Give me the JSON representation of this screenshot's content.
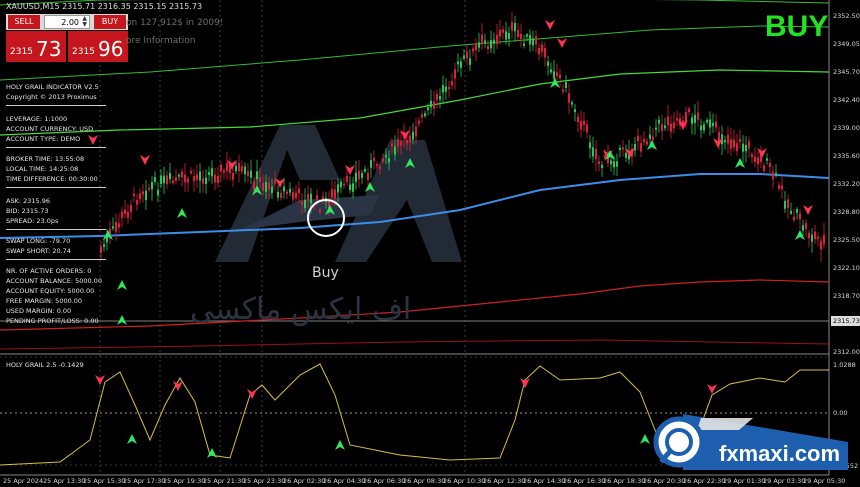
{
  "header": {
    "symbol_line": "XAUUSD,M15  2315.71 2316.35 2315.15 2315.73"
  },
  "trade_panel": {
    "sell_label": "SELL",
    "buy_label": "BUY",
    "lot": "2.00",
    "bid_small": "2315",
    "bid_big": "73",
    "ask_small": "2315",
    "ask_big": "96"
  },
  "overlay_text": {
    "line1": "on 127,912$ in 2009!",
    "line2": "ore Information"
  },
  "signal": {
    "label": "BUY",
    "color": "#22e322"
  },
  "indicator_info": {
    "title": "HOLY GRAIL INDICATOR V2.5",
    "copyright": "Copyright © 2013 Proximus",
    "leverage": "LEVERAGE:   1:1000",
    "currency": "ACCOUNT CURRENCY:   USD",
    "acct_type": "ACCOUNT TYPE:   DEMO",
    "broker_time": "BROKER TIME:   13:55:08",
    "local_time": "LOCAL TIME:   14:25:08",
    "time_diff": "TIME DIFFERENCE:   00:30:00",
    "ask": "ASK:   2315.96",
    "bid": "BID:   2315.73",
    "spread": "SPREAD:   23.0ps",
    "swap_long": "SWAP LONG:   -79.70",
    "swap_short": "SWAP SHORT:   20.74",
    "active_orders": "NR. OF ACTIVE ORDERS:   0",
    "balance": "ACCOUNT BALANCE:   5000.00",
    "equity": "ACCOUNT EQUITY:   5000.00",
    "free_margin": "FREE MARGIN:   5000.00",
    "used_margin": "USED MARGIN:   0.00",
    "pending_pl": "PENDING PROFIT/LOSS:   0.00"
  },
  "price_axis": [
    "2352.50",
    "2349.05",
    "2345.70",
    "2342.40",
    "2339.00",
    "2335.60",
    "2332.20",
    "2328.80",
    "2325.50",
    "2322.10",
    "2318.70",
    "2315.73",
    "2312.00"
  ],
  "current_price": "2315.73",
  "subwindow": {
    "title": "HOLY GRAIL 2.5 -0.1429",
    "axis": [
      "1.0288",
      "0.00",
      "-1.0552"
    ]
  },
  "time_axis": [
    "25 Apr 2024",
    "25 Apr 13:30",
    "25 Apr 15:30",
    "25 Apr 17:30",
    "25 Apr 19:30",
    "25 Apr 21:30",
    "25 Apr 23:30",
    "26 Apr 02:30",
    "26 Apr 04:30",
    "26 Apr 06:30",
    "26 Apr 08:30",
    "26 Apr 10:30",
    "26 Apr 12:30",
    "26 Apr 14:30",
    "26 Apr 16:30",
    "26 Apr 18:30",
    "26 Apr 20:30",
    "26 Apr 22:30",
    "29 Apr 01:30",
    "29 Apr 03:30",
    "29 Apr 05:30"
  ],
  "annotation": {
    "buy_text": "Buy"
  },
  "watermark": {
    "arabic": "اف ایکس ماکسی",
    "brand": "fxmaxi.com"
  },
  "colors": {
    "bull": "#22cc55",
    "bear": "#e0203a",
    "ma_blue": "#3a8ee8",
    "band_green": "#33bb33",
    "band_red": "#cc2222",
    "osc": "#d8c040",
    "arrow_up": "#2ee860",
    "arrow_down": "#ff3355"
  }
}
